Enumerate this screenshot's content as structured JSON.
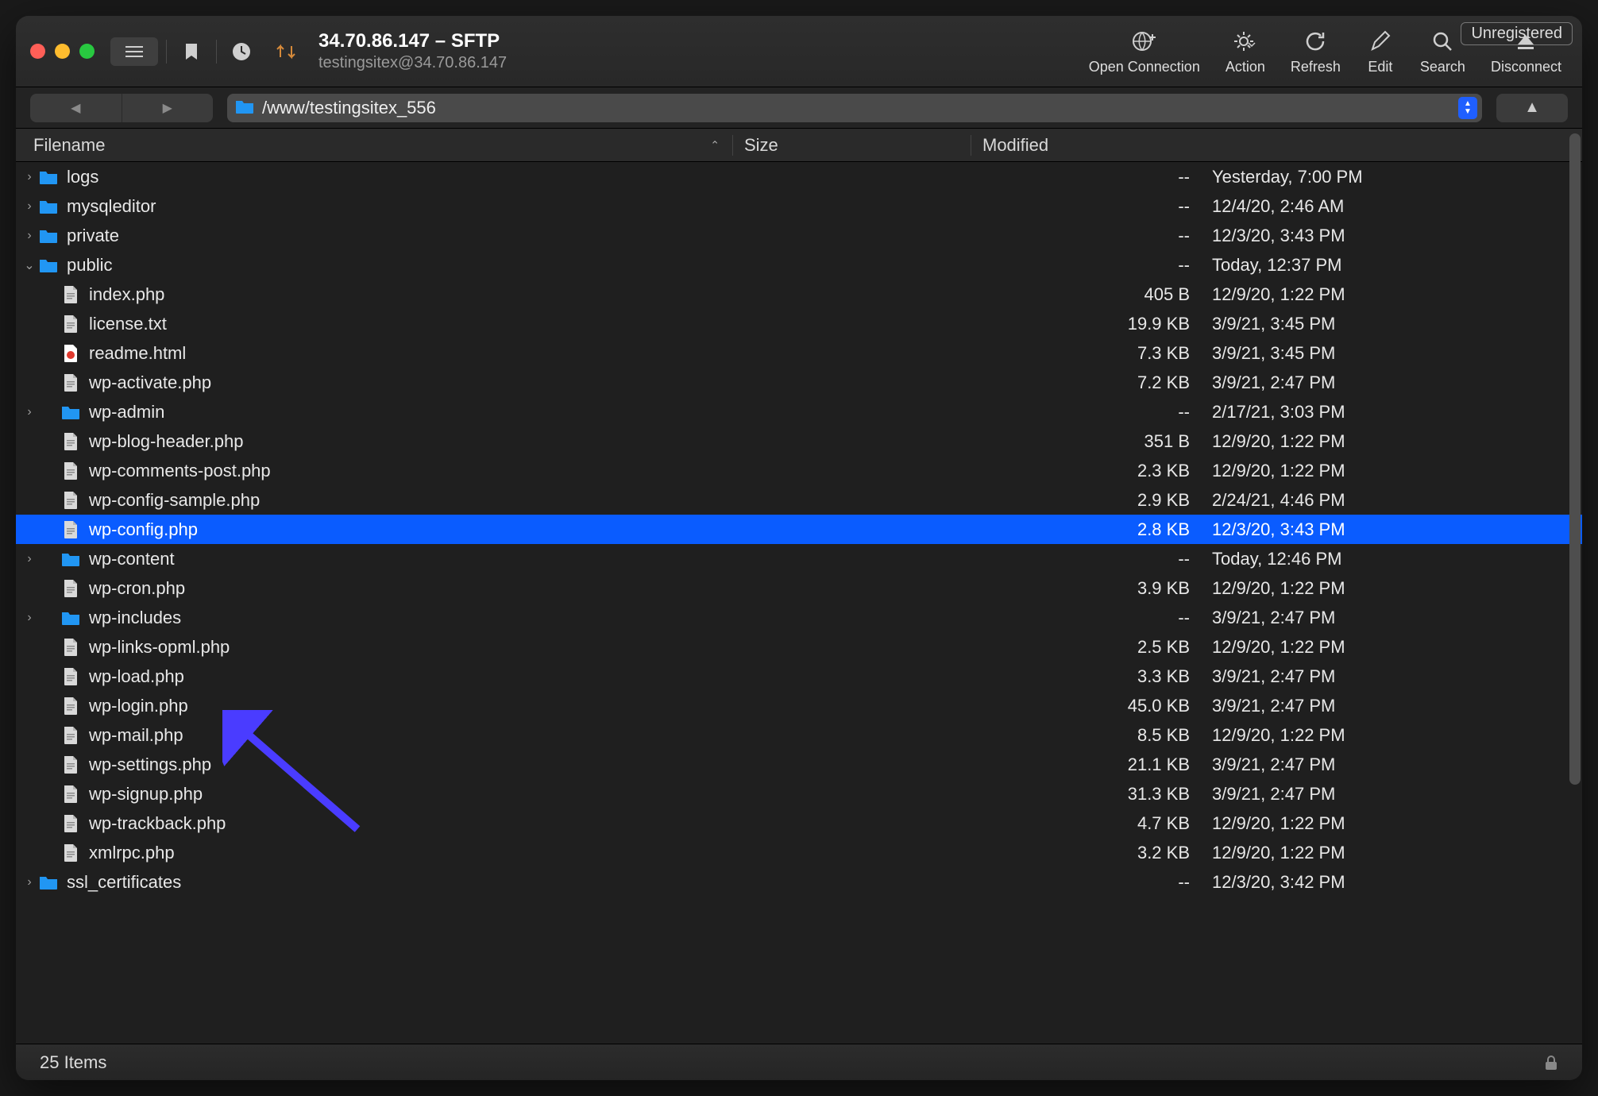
{
  "window": {
    "title": "34.70.86.147 – SFTP",
    "subtitle": "testingsitex@34.70.86.147",
    "unregistered_label": "Unregistered"
  },
  "toolbar": {
    "open_connection": "Open Connection",
    "action": "Action",
    "refresh": "Refresh",
    "edit": "Edit",
    "search": "Search",
    "disconnect": "Disconnect"
  },
  "path": "/www/testingsitex_556",
  "columns": {
    "filename": "Filename",
    "size": "Size",
    "modified": "Modified"
  },
  "status": {
    "count": "25 Items"
  },
  "colors": {
    "selection": "#0a5cff",
    "folder": "#2196f3"
  },
  "rows": [
    {
      "indent": 0,
      "type": "folder",
      "expand": "closed",
      "name": "logs",
      "size": "--",
      "modified": "Yesterday, 7:00 PM"
    },
    {
      "indent": 0,
      "type": "folder",
      "expand": "closed",
      "name": "mysqleditor",
      "size": "--",
      "modified": "12/4/20, 2:46 AM"
    },
    {
      "indent": 0,
      "type": "folder",
      "expand": "closed",
      "name": "private",
      "size": "--",
      "modified": "12/3/20, 3:43 PM"
    },
    {
      "indent": 0,
      "type": "folder",
      "expand": "open",
      "name": "public",
      "size": "--",
      "modified": "Today, 12:37 PM"
    },
    {
      "indent": 1,
      "type": "file",
      "name": "index.php",
      "size": "405 B",
      "modified": "12/9/20, 1:22 PM"
    },
    {
      "indent": 1,
      "type": "file",
      "name": "license.txt",
      "size": "19.9 KB",
      "modified": "3/9/21, 3:45 PM"
    },
    {
      "indent": 1,
      "type": "html",
      "name": "readme.html",
      "size": "7.3 KB",
      "modified": "3/9/21, 3:45 PM"
    },
    {
      "indent": 1,
      "type": "file",
      "name": "wp-activate.php",
      "size": "7.2 KB",
      "modified": "3/9/21, 2:47 PM"
    },
    {
      "indent": 1,
      "type": "folder",
      "expand": "closed",
      "name": "wp-admin",
      "size": "--",
      "modified": "2/17/21, 3:03 PM"
    },
    {
      "indent": 1,
      "type": "file",
      "name": "wp-blog-header.php",
      "size": "351 B",
      "modified": "12/9/20, 1:22 PM"
    },
    {
      "indent": 1,
      "type": "file",
      "name": "wp-comments-post.php",
      "size": "2.3 KB",
      "modified": "12/9/20, 1:22 PM"
    },
    {
      "indent": 1,
      "type": "file",
      "name": "wp-config-sample.php",
      "size": "2.9 KB",
      "modified": "2/24/21, 4:46 PM"
    },
    {
      "indent": 1,
      "type": "file",
      "name": "wp-config.php",
      "size": "2.8 KB",
      "modified": "12/3/20, 3:43 PM",
      "selected": true
    },
    {
      "indent": 1,
      "type": "folder",
      "expand": "closed",
      "name": "wp-content",
      "size": "--",
      "modified": "Today, 12:46 PM"
    },
    {
      "indent": 1,
      "type": "file",
      "name": "wp-cron.php",
      "size": "3.9 KB",
      "modified": "12/9/20, 1:22 PM"
    },
    {
      "indent": 1,
      "type": "folder",
      "expand": "closed",
      "name": "wp-includes",
      "size": "--",
      "modified": "3/9/21, 2:47 PM"
    },
    {
      "indent": 1,
      "type": "file",
      "name": "wp-links-opml.php",
      "size": "2.5 KB",
      "modified": "12/9/20, 1:22 PM"
    },
    {
      "indent": 1,
      "type": "file",
      "name": "wp-load.php",
      "size": "3.3 KB",
      "modified": "3/9/21, 2:47 PM"
    },
    {
      "indent": 1,
      "type": "file",
      "name": "wp-login.php",
      "size": "45.0 KB",
      "modified": "3/9/21, 2:47 PM"
    },
    {
      "indent": 1,
      "type": "file",
      "name": "wp-mail.php",
      "size": "8.5 KB",
      "modified": "12/9/20, 1:22 PM"
    },
    {
      "indent": 1,
      "type": "file",
      "name": "wp-settings.php",
      "size": "21.1 KB",
      "modified": "3/9/21, 2:47 PM"
    },
    {
      "indent": 1,
      "type": "file",
      "name": "wp-signup.php",
      "size": "31.3 KB",
      "modified": "3/9/21, 2:47 PM"
    },
    {
      "indent": 1,
      "type": "file",
      "name": "wp-trackback.php",
      "size": "4.7 KB",
      "modified": "12/9/20, 1:22 PM"
    },
    {
      "indent": 1,
      "type": "file",
      "name": "xmlrpc.php",
      "size": "3.2 KB",
      "modified": "12/9/20, 1:22 PM"
    },
    {
      "indent": 0,
      "type": "folder",
      "expand": "closed",
      "name": "ssl_certificates",
      "size": "--",
      "modified": "12/3/20, 3:42 PM"
    }
  ]
}
